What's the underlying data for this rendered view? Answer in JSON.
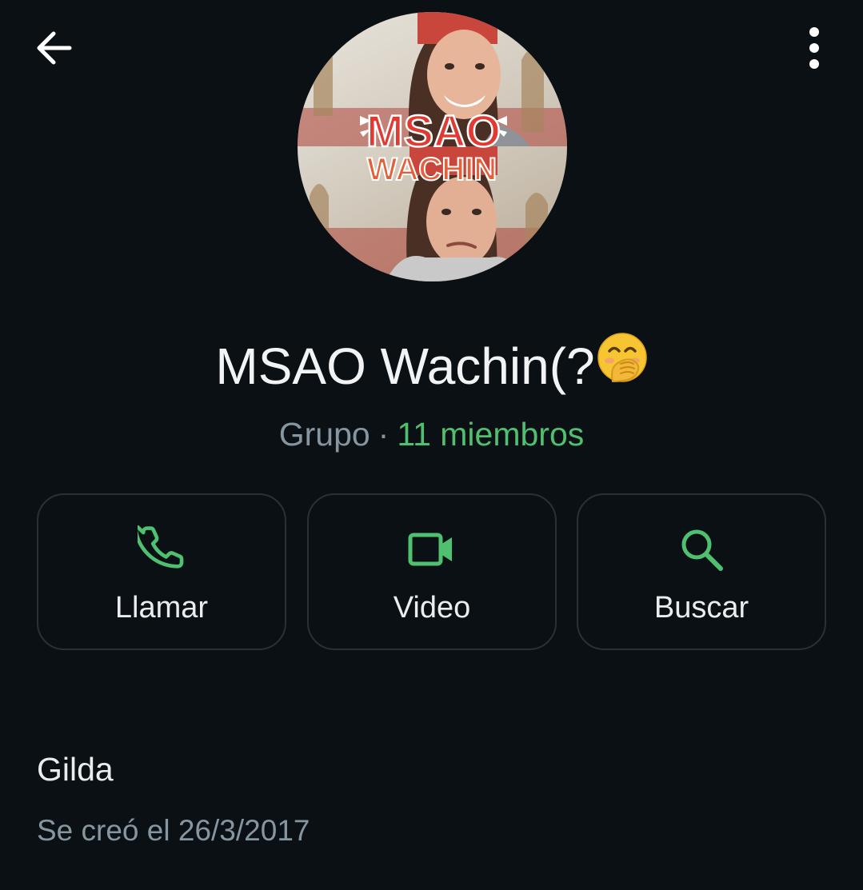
{
  "header": {
    "back_icon": "arrow-left-icon",
    "menu_icon": "more-vertical-icon"
  },
  "group": {
    "name": "MSAO Wachin(?",
    "name_emoji": "face-with-hand-over-mouth",
    "kind": "Grupo",
    "separator": "·",
    "members": "11 miembros"
  },
  "avatar": {
    "logo_line1": "MSAO",
    "logo_line2": "WACHIN"
  },
  "actions": {
    "call_label": "Llamar",
    "video_label": "Video",
    "search_label": "Buscar"
  },
  "info": {
    "description": "Gilda",
    "created": "Se creó el 26/3/2017"
  },
  "colors": {
    "background": "#0b1014",
    "accent": "#4fc070",
    "secondary_text": "#8696a0",
    "primary_text": "#e9edef",
    "button_border": "#2a3136"
  }
}
